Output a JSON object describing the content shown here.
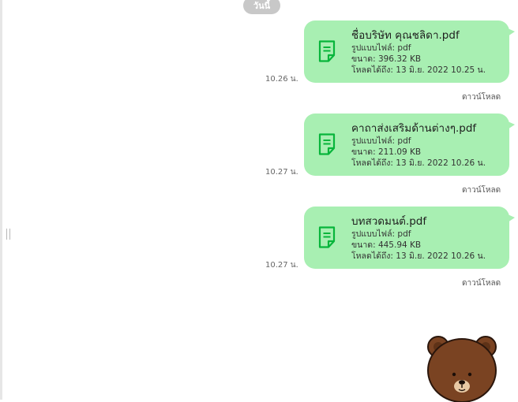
{
  "date_divider": "วันนี้",
  "messages": [
    {
      "file_name": "ชื่อบริษัท คุณชลิดา.pdf",
      "file_type": "รูปแบบไฟล์: pdf",
      "file_size": "ขนาด: 396.32 KB",
      "available_until": "โหลดได้ถึง: 13 มิ.ย. 2022 10.25 น.",
      "time": "10.26 น.",
      "download_label": "ดาวน์โหลด"
    },
    {
      "file_name": "คาถาส่งเสริมด้านต่างๆ.pdf",
      "file_type": "รูปแบบไฟล์: pdf",
      "file_size": "ขนาด: 211.09 KB",
      "available_until": "โหลดได้ถึง: 13 มิ.ย. 2022 10.26 น.",
      "time": "10.27 น.",
      "download_label": "ดาวน์โหลด"
    },
    {
      "file_name": "บทสวดมนต์.pdf",
      "file_type": "รูปแบบไฟล์: pdf",
      "file_size": "ขนาด: 445.94 KB",
      "available_until": "โหลดได้ถึง: 13 มิ.ย. 2022 10.26 น.",
      "time": "10.27 น.",
      "download_label": "ดาวน์โหลด"
    }
  ],
  "colors": {
    "bubble": "#a8efb2",
    "file_icon": "#07b53b",
    "date_pill": "#c8c8c8"
  },
  "icons": {
    "file": "file-document-icon",
    "sticker": "brown-bear-sticker"
  }
}
